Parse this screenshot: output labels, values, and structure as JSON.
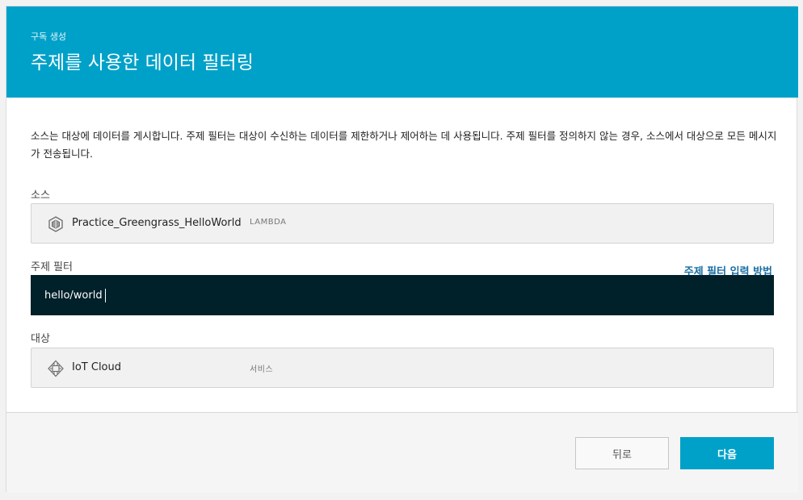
{
  "header": {
    "eyebrow": "구독 생성",
    "title": "주제를 사용한 데이터 필터링"
  },
  "description": "소스는 대상에 데이터를 게시합니다. 주제 필터는 대상이 수신하는 데이터를 제한하거나 제어하는 데 사용됩니다. 주제 필터를 정의하지 않는 경우, 소스에서 대상으로 모든 메시지가 전송됩니다.",
  "source": {
    "label": "소스",
    "name": "Practice_Greengrass_HelloWorld",
    "type": "LAMBDA",
    "icon": "lambda-icon"
  },
  "topic_filter": {
    "label": "주제 필터",
    "help_link": "주제 필터 입력 방법",
    "value": "hello/world"
  },
  "target": {
    "label": "대상",
    "name": "IoT Cloud",
    "type": "서비스",
    "icon": "iot-cloud-icon"
  },
  "footer": {
    "back_label": "뒤로",
    "next_label": "다음"
  },
  "colors": {
    "header_bg": "#00a1c9",
    "input_bg": "#00202a",
    "link": "#1a6fa3",
    "primary_button": "#00a1c9"
  }
}
